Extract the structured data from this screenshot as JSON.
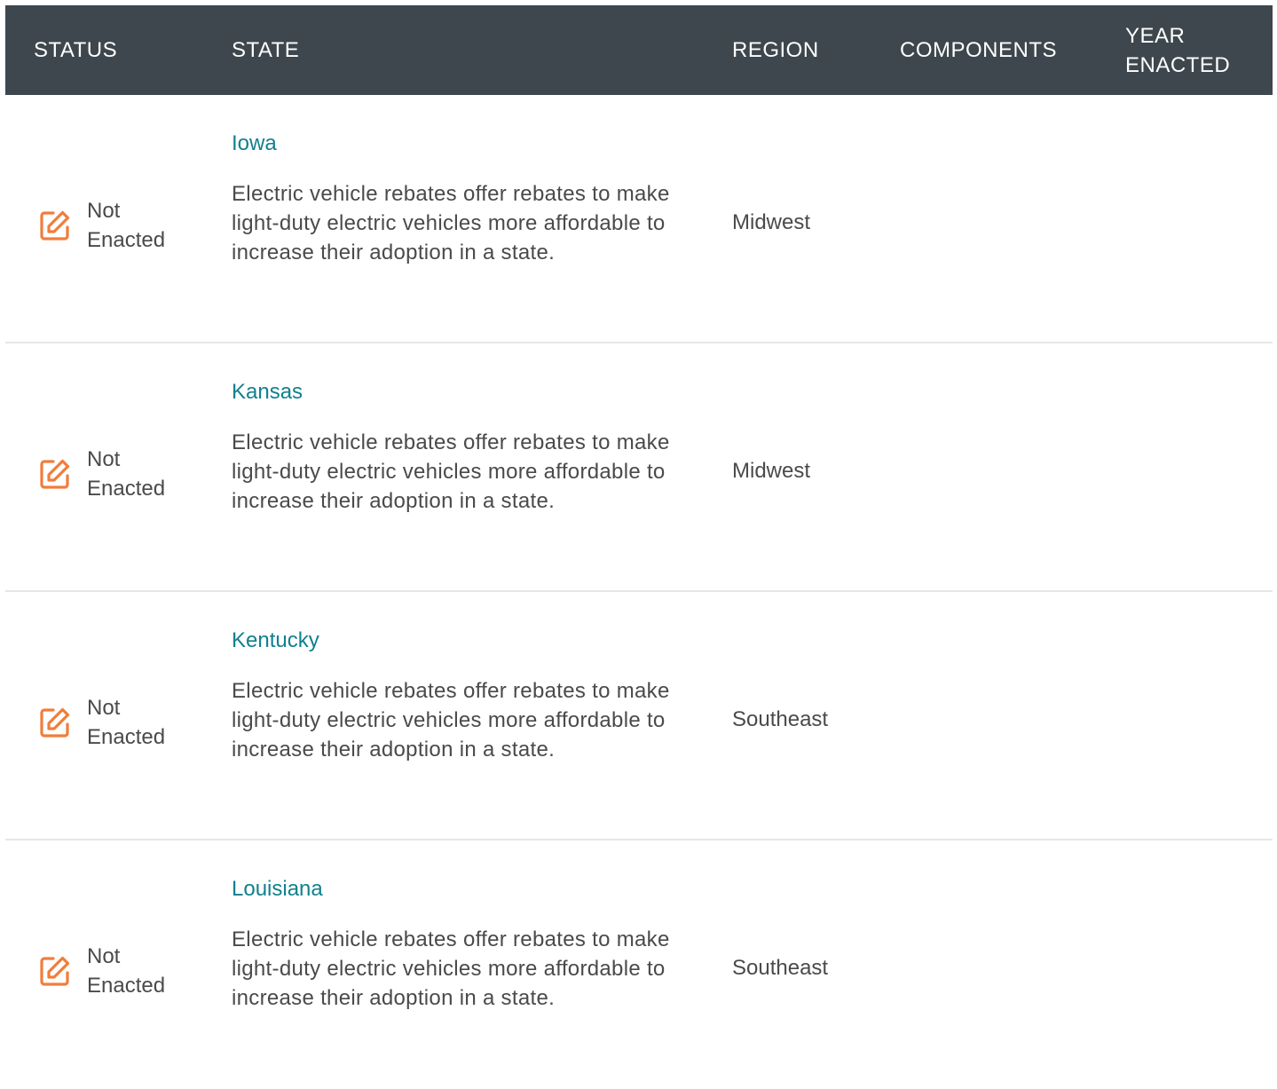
{
  "colors": {
    "header_bg": "#3d474d",
    "link": "#11808f",
    "status_icon": "#f07d3b",
    "text": "#4a4a4a",
    "divider": "#e3e7ea"
  },
  "header": {
    "status": "STATUS",
    "state": "STATE",
    "region": "REGION",
    "components": "COMPONENTS",
    "year_line1": "YEAR",
    "year_line2": "ENACTED"
  },
  "rows": [
    {
      "status_icon": "edit-icon",
      "status_line1": "Not",
      "status_line2": "Enacted",
      "state": "Iowa",
      "description": "Electric vehicle rebates offer rebates to make light-duty electric vehicles more affordable to increase their adoption in a state.",
      "region": "Midwest",
      "components": "",
      "year": ""
    },
    {
      "status_icon": "edit-icon",
      "status_line1": "Not",
      "status_line2": "Enacted",
      "state": "Kansas",
      "description": "Electric vehicle rebates offer rebates to make light-duty electric vehicles more affordable to increase their adoption in a state.",
      "region": "Midwest",
      "components": "",
      "year": ""
    },
    {
      "status_icon": "edit-icon",
      "status_line1": "Not",
      "status_line2": "Enacted",
      "state": "Kentucky",
      "description": "Electric vehicle rebates offer rebates to make light-duty electric vehicles more affordable to increase their adoption in a state.",
      "region": "Southeast",
      "components": "",
      "year": ""
    },
    {
      "status_icon": "edit-icon",
      "status_line1": "Not",
      "status_line2": "Enacted",
      "state": "Louisiana",
      "description": "Electric vehicle rebates offer rebates to make light-duty electric vehicles more affordable to increase their adoption in a state.",
      "region": "Southeast",
      "components": "",
      "year": ""
    }
  ]
}
